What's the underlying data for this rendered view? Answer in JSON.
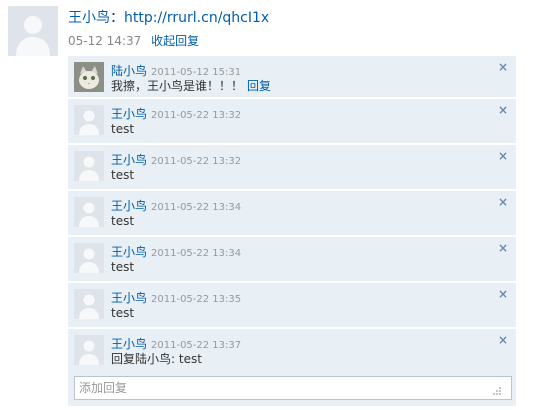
{
  "status": {
    "user_name": "王小鸟",
    "separator": "：",
    "link": "http://rrurl.cn/qhcI1x",
    "time": "05-12 14:37",
    "collapse_label": "收起回复"
  },
  "comments": [
    {
      "name": "陆小鸟",
      "time": "2011-05-12 15:31",
      "text": "我擦，王小鸟是谁！！！",
      "reply_label": "回复",
      "avatar": "cat-avatar",
      "close": "×"
    },
    {
      "name": "王小鸟",
      "time": "2011-05-22 13:32",
      "text": "test",
      "avatar": "default-avatar",
      "close": "×"
    },
    {
      "name": "王小鸟",
      "time": "2011-05-22 13:32",
      "text": "test",
      "avatar": "default-avatar",
      "close": "×"
    },
    {
      "name": "王小鸟",
      "time": "2011-05-22 13:34",
      "text": "test",
      "avatar": "default-avatar",
      "close": "×"
    },
    {
      "name": "王小鸟",
      "time": "2011-05-22 13:34",
      "text": "test",
      "avatar": "default-avatar",
      "close": "×"
    },
    {
      "name": "王小鸟",
      "time": "2011-05-22 13:35",
      "text": "test",
      "avatar": "default-avatar",
      "close": "×"
    },
    {
      "name": "王小鸟",
      "time": "2011-05-22 13:37",
      "text": "回复陆小鸟: test",
      "avatar": "default-avatar",
      "close": "×"
    }
  ],
  "add_reply": {
    "placeholder": "添加回复"
  },
  "colors": {
    "link": "#005eac",
    "panel": "#e8eff5",
    "close": "#6b8bb3"
  }
}
